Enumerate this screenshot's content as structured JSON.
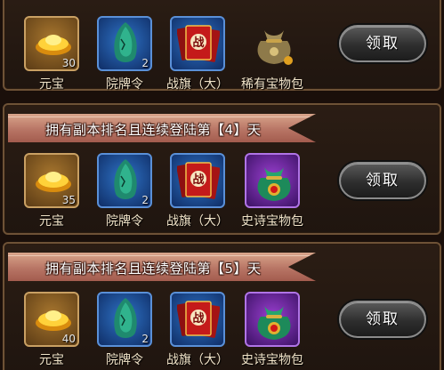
{
  "rows": [
    {
      "banner": "",
      "button_label": "领取",
      "items": [
        {
          "icon": "gold-ingot-icon",
          "name": "元宝",
          "qty": "30",
          "frame": "gold"
        },
        {
          "icon": "green-gem-icon",
          "name": "院牌令",
          "qty": "2",
          "frame": "blue"
        },
        {
          "icon": "war-flag-icon",
          "name": "战旗（大）",
          "qty": "",
          "frame": "blue"
        },
        {
          "icon": "treasure-bag-icon",
          "name": "稀有宝物包",
          "qty": "",
          "frame": "none"
        }
      ]
    },
    {
      "banner": "拥有副本排名且连续登陆第【4】天",
      "button_label": "领取",
      "items": [
        {
          "icon": "gold-ingot-icon",
          "name": "元宝",
          "qty": "35",
          "frame": "gold"
        },
        {
          "icon": "green-gem-icon",
          "name": "院牌令",
          "qty": "2",
          "frame": "blue"
        },
        {
          "icon": "war-flag-icon",
          "name": "战旗（大）",
          "qty": "",
          "frame": "blue"
        },
        {
          "icon": "treasure-bag-icon",
          "name": "史诗宝物包",
          "qty": "",
          "frame": "purple"
        }
      ]
    },
    {
      "banner": "拥有副本排名且连续登陆第【5】天",
      "button_label": "领取",
      "items": [
        {
          "icon": "gold-ingot-icon",
          "name": "元宝",
          "qty": "40",
          "frame": "gold"
        },
        {
          "icon": "green-gem-icon",
          "name": "院牌令",
          "qty": "2",
          "frame": "blue"
        },
        {
          "icon": "war-flag-icon",
          "name": "战旗（大）",
          "qty": "",
          "frame": "blue"
        },
        {
          "icon": "treasure-bag-icon",
          "name": "史诗宝物包",
          "qty": "",
          "frame": "purple"
        }
      ]
    }
  ],
  "colors": {
    "panel_border": "#6e5236",
    "banner": "#b87565",
    "item_label": "#f0e3c8"
  }
}
